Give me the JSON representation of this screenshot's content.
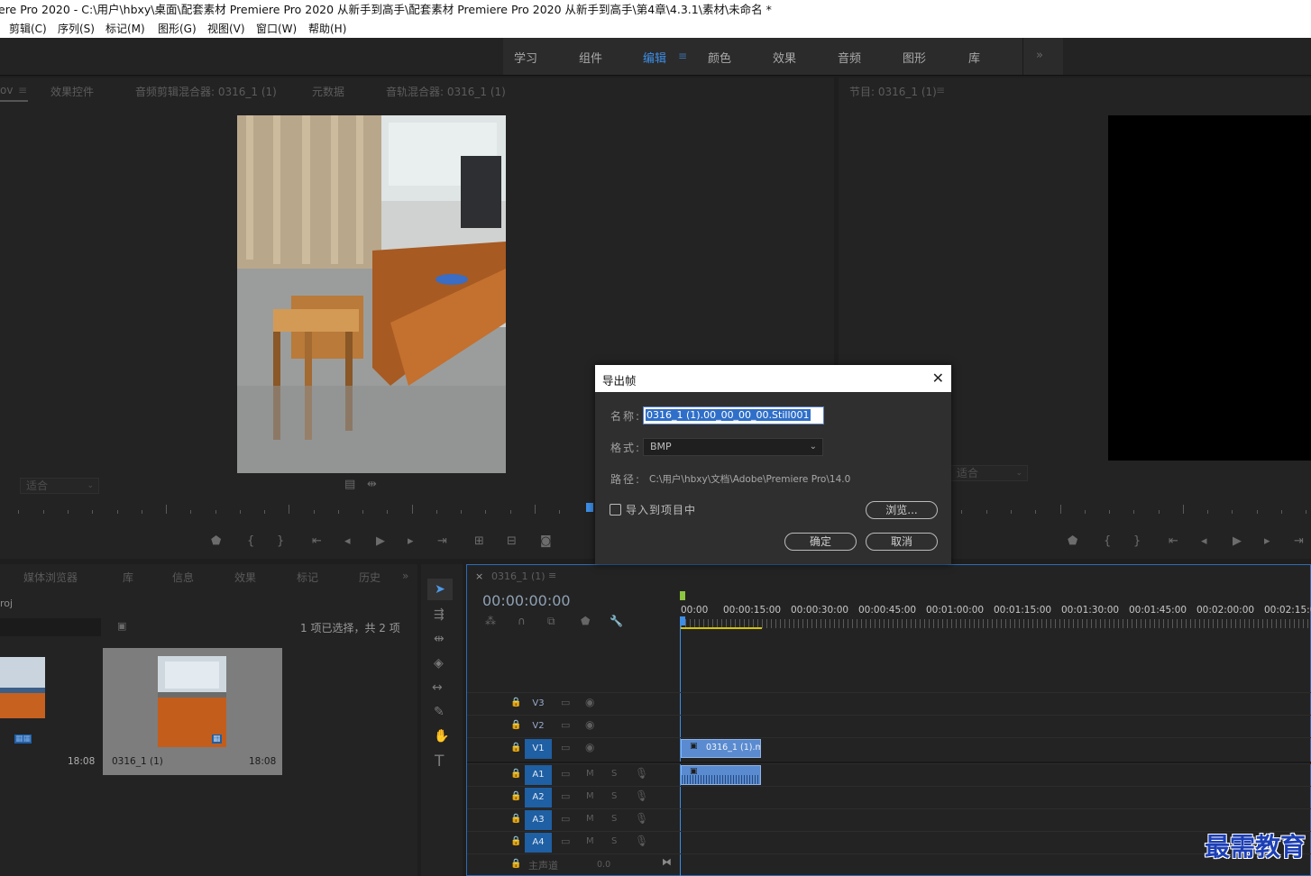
{
  "window": {
    "title": "ere Pro 2020 - C:\\用户\\hbxy\\桌面\\配套素材 Premiere Pro 2020 从新手到高手\\配套素材 Premiere Pro 2020 从新手到高手\\第4章\\4.3.1\\素材\\未命名 *"
  },
  "menu": [
    "剪辑(C)",
    "序列(S)",
    "标记(M)",
    "图形(G)",
    "视图(V)",
    "窗口(W)",
    "帮助(H)"
  ],
  "workspaces": {
    "tabs": [
      "学习",
      "组件",
      "编辑",
      "颜色",
      "效果",
      "音频",
      "图形",
      "库"
    ],
    "active": "编辑",
    "more": "»"
  },
  "source_panel": {
    "tabs": [
      "ov",
      "效果控件",
      "音频剪辑混合器: 0316_1 (1)",
      "元数据",
      "音轨混合器: 0316_1 (1)"
    ],
    "fit": "适合"
  },
  "program_panel": {
    "tab": "节目: 0316_1 (1)",
    "fit": "适合"
  },
  "project_panel": {
    "tabs": [
      "媒体浏览器",
      "库",
      "信息",
      "效果",
      "标记",
      "历史"
    ],
    "name": "roj",
    "selection_status": "1 项已选择，共 2 项",
    "items": [
      {
        "name": "",
        "duration": "18:08"
      },
      {
        "name": "0316_1 (1)",
        "duration": "18:08"
      }
    ]
  },
  "timeline": {
    "tab": "0316_1 (1)",
    "timecode": "00:00:00:00",
    "ruler": [
      "00:00",
      "00:00:15:00",
      "00:00:30:00",
      "00:00:45:00",
      "00:01:00:00",
      "00:01:15:00",
      "00:01:30:00",
      "00:01:45:00",
      "00:02:00:00",
      "00:02:15:00"
    ],
    "video_tracks": [
      "V3",
      "V2",
      "V1"
    ],
    "audio_tracks": [
      "A1",
      "A2",
      "A3",
      "A4"
    ],
    "master": "主声道",
    "master_value": "0.0",
    "clip_name": "0316_1 (1).mo",
    "mute": "M",
    "solo": "S"
  },
  "dialog": {
    "title": "导出帧",
    "name_label": "名称:",
    "name_value": "0316_1 (1).00_00_00_00.Still001",
    "format_label": "格式:",
    "format_value": "BMP",
    "path_label": "路径:",
    "path_value": "C:\\用户\\hbxy\\文档\\Adobe\\Premiere Pro\\14.0",
    "import_label": "导入到项目中",
    "import_checked": false,
    "browse": "浏览...",
    "ok": "确定",
    "cancel": "取消"
  },
  "watermark": "最需教育",
  "colors": {
    "accent": "#3d8ee6",
    "track_active": "#1f5fa3",
    "clip": "#5a8bd0"
  }
}
